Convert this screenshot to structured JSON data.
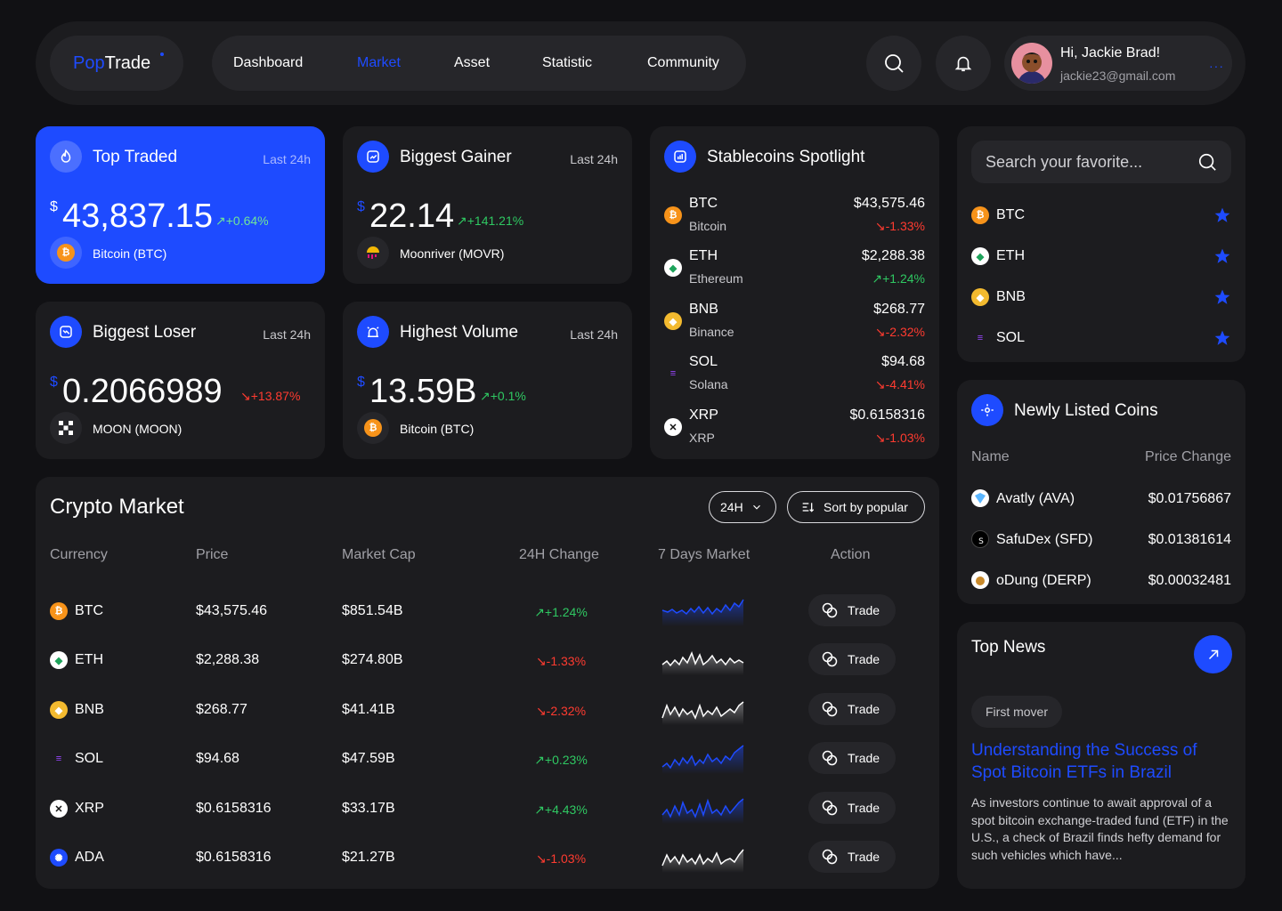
{
  "header": {
    "logo_part1": "Pop",
    "logo_part2": "Trade",
    "nav": [
      "Dashboard",
      "Market",
      "Asset",
      "Statistic",
      "Community"
    ],
    "active_nav": "Market",
    "user_greeting": "Hi, Jackie Brad!",
    "user_email": "jackie23@gmail.com",
    "more": "···"
  },
  "colors": {
    "accent": "#1E4BFF",
    "up": "#2fc862",
    "down": "#ff3b30",
    "card": "#1c1c1f",
    "bg": "#111114"
  },
  "highlights": [
    {
      "title": "Top Traded",
      "period": "Last 24h",
      "currency": "$",
      "value": "43,837.15",
      "change": "↗+0.64%",
      "dir": "up",
      "coin": "Bitcoin (BTC)",
      "icon": "flame-icon"
    },
    {
      "title": "Biggest Gainer",
      "period": "Last 24h",
      "currency": "$",
      "value": "22.14",
      "change": "↗+141.21%",
      "dir": "up",
      "coin": "Moonriver (MOVR)",
      "icon": "trend-up-icon"
    },
    {
      "title": "Biggest Loser",
      "period": "Last 24h",
      "currency": "$",
      "value": "0.2066989",
      "change": "↘+13.87%",
      "dir": "down",
      "coin": "MOON (MOON)",
      "icon": "trend-down-icon"
    },
    {
      "title": "Highest Volume",
      "period": "Last 24h",
      "currency": "$",
      "value": "13.59B",
      "change": "↗+0.1%",
      "dir": "up",
      "coin": "Bitcoin (BTC)",
      "icon": "alarm-icon"
    }
  ],
  "stablecoins": {
    "title": "Stablecoins Spotlight",
    "rows": [
      {
        "sym": "BTC",
        "name": "Bitcoin",
        "price": "$43,575.46",
        "change": "↘-1.33%",
        "dir": "down"
      },
      {
        "sym": "ETH",
        "name": "Ethereum",
        "price": "$2,288.38",
        "change": "↗+1.24%",
        "dir": "up"
      },
      {
        "sym": "BNB",
        "name": "Binance",
        "price": "$268.77",
        "change": "↘-2.32%",
        "dir": "down"
      },
      {
        "sym": "SOL",
        "name": "Solana",
        "price": "$94.68",
        "change": "↘-4.41%",
        "dir": "down"
      },
      {
        "sym": "XRP",
        "name": "XRP",
        "price": "$0.6158316",
        "change": "↘-1.03%",
        "dir": "down"
      }
    ]
  },
  "search": {
    "placeholder": "Search your favorite..."
  },
  "favorites": [
    "BTC",
    "ETH",
    "BNB",
    "SOL"
  ],
  "market": {
    "title": "Crypto Market",
    "period_btn": "24H",
    "sort_btn": "Sort by popular",
    "headers": [
      "Currency",
      "Price",
      "Market Cap",
      "24H Change",
      "7 Days Market",
      "Action"
    ],
    "trade_label": "Trade",
    "rows": [
      {
        "cur": "BTC",
        "price": "$43,575.46",
        "cap": "$851.54B",
        "change": "↗+1.24%",
        "dir": "up"
      },
      {
        "cur": "ETH",
        "price": "$2,288.38",
        "cap": "$274.80B",
        "change": "↘-1.33%",
        "dir": "down"
      },
      {
        "cur": "BNB",
        "price": "$268.77",
        "cap": "$41.41B",
        "change": "↘-2.32%",
        "dir": "down"
      },
      {
        "cur": "SOL",
        "price": "$94.68",
        "cap": "$47.59B",
        "change": "↗+0.23%",
        "dir": "up"
      },
      {
        "cur": "XRP",
        "price": "$0.6158316",
        "cap": "$33.17B",
        "change": "↗+4.43%",
        "dir": "up"
      },
      {
        "cur": "ADA",
        "price": "$0.6158316",
        "cap": "$21.27B",
        "change": "↘-1.03%",
        "dir": "down"
      }
    ]
  },
  "newly_listed": {
    "title": "Newly Listed Coins",
    "col_name": "Name",
    "col_change": "Price Change",
    "rows": [
      {
        "name": "Avatly (AVA)",
        "price": "$0.01756867"
      },
      {
        "name": "SafuDex (SFD)",
        "price": "$0.01381614"
      },
      {
        "name": "oDung (DERP)",
        "price": "$0.00032481"
      }
    ]
  },
  "news": {
    "title": "Top News",
    "tag": "First mover",
    "headline": "Understanding the Success of Spot Bitcoin ETFs in Brazil",
    "body": "As investors continue to await approval of a spot bitcoin exchange-traded fund (ETF) in the U.S., a check of Brazil finds hefty demand for such vehicles which have..."
  }
}
